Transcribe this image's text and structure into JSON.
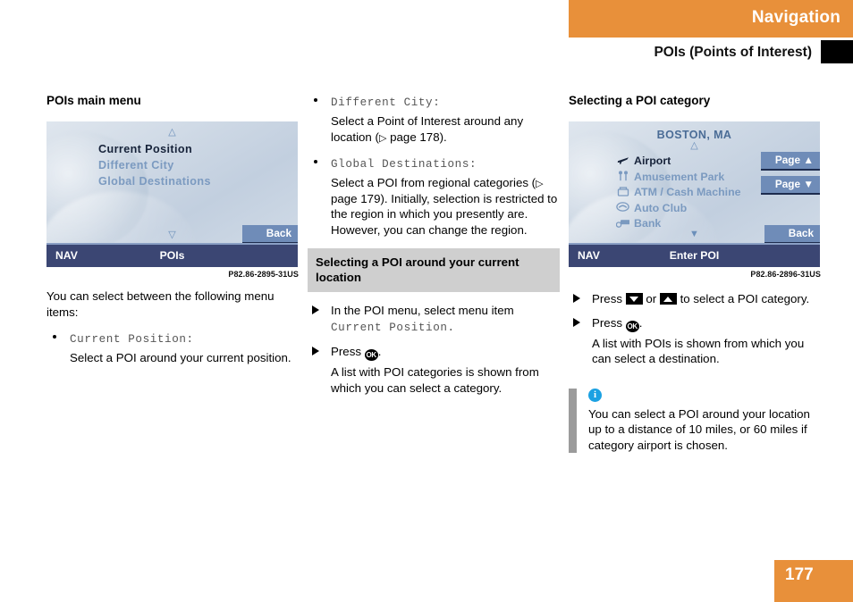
{
  "header": {
    "section": "Navigation",
    "subsection": "POIs (Points of Interest)"
  },
  "page_number": "177",
  "left_column": {
    "heading": "POIs main menu",
    "screen": {
      "up_arrow": "△",
      "down_arrow": "▽",
      "menu_items": [
        {
          "label": "Current Position",
          "selected": true
        },
        {
          "label": "Different City",
          "selected": false
        },
        {
          "label": "Global Destinations",
          "selected": false
        }
      ],
      "back_button": "Back",
      "bottom_left": "NAV",
      "bottom_center": "POIs",
      "caption": "P82.86-2895-31US"
    },
    "intro": "You can select between the following menu items:",
    "bullets": [
      {
        "term": "Current Position:",
        "text": "Select a POI around your current position."
      }
    ]
  },
  "middle_column": {
    "bullets": [
      {
        "term": "Different City:",
        "text_before": "Select a Point of Interest around any location (",
        "page_ref": "page 178",
        "text_after": ")."
      },
      {
        "term": "Global Destinations:",
        "text_before": "Select a POI from regional categories (",
        "page_ref": "page 179",
        "text_after": "). Initially, selection is restricted to the region in which you presently are. However, you can change the region."
      }
    ],
    "section_heading": "Selecting a POI around your current location",
    "steps": [
      {
        "text_before": "In the POI menu, select menu item ",
        "mono": "Current Position.",
        "text_after": ""
      },
      {
        "text_before": "Press ",
        "key": "OK",
        "text_after": "."
      }
    ],
    "step_result": "A list with POI categories is shown from which you can select a category."
  },
  "right_column": {
    "heading": "Selecting a POI category",
    "screen": {
      "title": "BOSTON, MA",
      "up_arrow": "△",
      "down_arrow": "▼",
      "categories": [
        {
          "icon": "airport-icon",
          "glyph": "✈",
          "label": "Airport",
          "selected": true
        },
        {
          "icon": "amusement-park-icon",
          "glyph": "⛲",
          "label": "Amusement Park",
          "selected": false
        },
        {
          "icon": "atm-icon",
          "glyph": "⬒",
          "label": "ATM / Cash Machine",
          "selected": false
        },
        {
          "icon": "auto-club-icon",
          "glyph": "◔",
          "label": "Auto Club",
          "selected": false
        },
        {
          "icon": "bank-icon",
          "glyph": "⛁",
          "label": "Bank",
          "selected": false
        }
      ],
      "page_up_button": "Page ▲",
      "page_down_button": "Page ▼",
      "back_button": "Back",
      "bottom_left": "NAV",
      "bottom_center": "Enter POI",
      "caption": "P82.86-2896-31US"
    },
    "steps": [
      {
        "text_before": "Press ",
        "key_down": "▼",
        "mid": " or ",
        "key_up": "▲",
        "text_after": " to select a POI category."
      },
      {
        "text_before": "Press ",
        "key": "OK",
        "text_after": "."
      }
    ],
    "step_result": "A list with POIs is shown from which you can select a destination.",
    "note": {
      "icon": "info-icon",
      "text": "You can select a POI around your location up to a distance of 10 miles, or 60 miles if category airport is chosen."
    }
  }
}
